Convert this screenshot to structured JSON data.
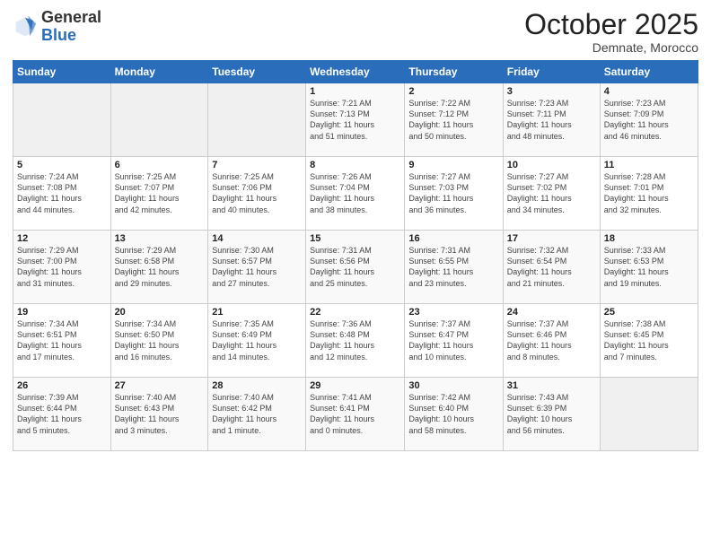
{
  "header": {
    "logo_general": "General",
    "logo_blue": "Blue",
    "month_title": "October 2025",
    "subtitle": "Demnate, Morocco"
  },
  "weekdays": [
    "Sunday",
    "Monday",
    "Tuesday",
    "Wednesday",
    "Thursday",
    "Friday",
    "Saturday"
  ],
  "weeks": [
    [
      {
        "day": "",
        "info": ""
      },
      {
        "day": "",
        "info": ""
      },
      {
        "day": "",
        "info": ""
      },
      {
        "day": "1",
        "info": "Sunrise: 7:21 AM\nSunset: 7:13 PM\nDaylight: 11 hours\nand 51 minutes."
      },
      {
        "day": "2",
        "info": "Sunrise: 7:22 AM\nSunset: 7:12 PM\nDaylight: 11 hours\nand 50 minutes."
      },
      {
        "day": "3",
        "info": "Sunrise: 7:23 AM\nSunset: 7:11 PM\nDaylight: 11 hours\nand 48 minutes."
      },
      {
        "day": "4",
        "info": "Sunrise: 7:23 AM\nSunset: 7:09 PM\nDaylight: 11 hours\nand 46 minutes."
      }
    ],
    [
      {
        "day": "5",
        "info": "Sunrise: 7:24 AM\nSunset: 7:08 PM\nDaylight: 11 hours\nand 44 minutes."
      },
      {
        "day": "6",
        "info": "Sunrise: 7:25 AM\nSunset: 7:07 PM\nDaylight: 11 hours\nand 42 minutes."
      },
      {
        "day": "7",
        "info": "Sunrise: 7:25 AM\nSunset: 7:06 PM\nDaylight: 11 hours\nand 40 minutes."
      },
      {
        "day": "8",
        "info": "Sunrise: 7:26 AM\nSunset: 7:04 PM\nDaylight: 11 hours\nand 38 minutes."
      },
      {
        "day": "9",
        "info": "Sunrise: 7:27 AM\nSunset: 7:03 PM\nDaylight: 11 hours\nand 36 minutes."
      },
      {
        "day": "10",
        "info": "Sunrise: 7:27 AM\nSunset: 7:02 PM\nDaylight: 11 hours\nand 34 minutes."
      },
      {
        "day": "11",
        "info": "Sunrise: 7:28 AM\nSunset: 7:01 PM\nDaylight: 11 hours\nand 32 minutes."
      }
    ],
    [
      {
        "day": "12",
        "info": "Sunrise: 7:29 AM\nSunset: 7:00 PM\nDaylight: 11 hours\nand 31 minutes."
      },
      {
        "day": "13",
        "info": "Sunrise: 7:29 AM\nSunset: 6:58 PM\nDaylight: 11 hours\nand 29 minutes."
      },
      {
        "day": "14",
        "info": "Sunrise: 7:30 AM\nSunset: 6:57 PM\nDaylight: 11 hours\nand 27 minutes."
      },
      {
        "day": "15",
        "info": "Sunrise: 7:31 AM\nSunset: 6:56 PM\nDaylight: 11 hours\nand 25 minutes."
      },
      {
        "day": "16",
        "info": "Sunrise: 7:31 AM\nSunset: 6:55 PM\nDaylight: 11 hours\nand 23 minutes."
      },
      {
        "day": "17",
        "info": "Sunrise: 7:32 AM\nSunset: 6:54 PM\nDaylight: 11 hours\nand 21 minutes."
      },
      {
        "day": "18",
        "info": "Sunrise: 7:33 AM\nSunset: 6:53 PM\nDaylight: 11 hours\nand 19 minutes."
      }
    ],
    [
      {
        "day": "19",
        "info": "Sunrise: 7:34 AM\nSunset: 6:51 PM\nDaylight: 11 hours\nand 17 minutes."
      },
      {
        "day": "20",
        "info": "Sunrise: 7:34 AM\nSunset: 6:50 PM\nDaylight: 11 hours\nand 16 minutes."
      },
      {
        "day": "21",
        "info": "Sunrise: 7:35 AM\nSunset: 6:49 PM\nDaylight: 11 hours\nand 14 minutes."
      },
      {
        "day": "22",
        "info": "Sunrise: 7:36 AM\nSunset: 6:48 PM\nDaylight: 11 hours\nand 12 minutes."
      },
      {
        "day": "23",
        "info": "Sunrise: 7:37 AM\nSunset: 6:47 PM\nDaylight: 11 hours\nand 10 minutes."
      },
      {
        "day": "24",
        "info": "Sunrise: 7:37 AM\nSunset: 6:46 PM\nDaylight: 11 hours\nand 8 minutes."
      },
      {
        "day": "25",
        "info": "Sunrise: 7:38 AM\nSunset: 6:45 PM\nDaylight: 11 hours\nand 7 minutes."
      }
    ],
    [
      {
        "day": "26",
        "info": "Sunrise: 7:39 AM\nSunset: 6:44 PM\nDaylight: 11 hours\nand 5 minutes."
      },
      {
        "day": "27",
        "info": "Sunrise: 7:40 AM\nSunset: 6:43 PM\nDaylight: 11 hours\nand 3 minutes."
      },
      {
        "day": "28",
        "info": "Sunrise: 7:40 AM\nSunset: 6:42 PM\nDaylight: 11 hours\nand 1 minute."
      },
      {
        "day": "29",
        "info": "Sunrise: 7:41 AM\nSunset: 6:41 PM\nDaylight: 11 hours\nand 0 minutes."
      },
      {
        "day": "30",
        "info": "Sunrise: 7:42 AM\nSunset: 6:40 PM\nDaylight: 10 hours\nand 58 minutes."
      },
      {
        "day": "31",
        "info": "Sunrise: 7:43 AM\nSunset: 6:39 PM\nDaylight: 10 hours\nand 56 minutes."
      },
      {
        "day": "",
        "info": ""
      }
    ]
  ]
}
